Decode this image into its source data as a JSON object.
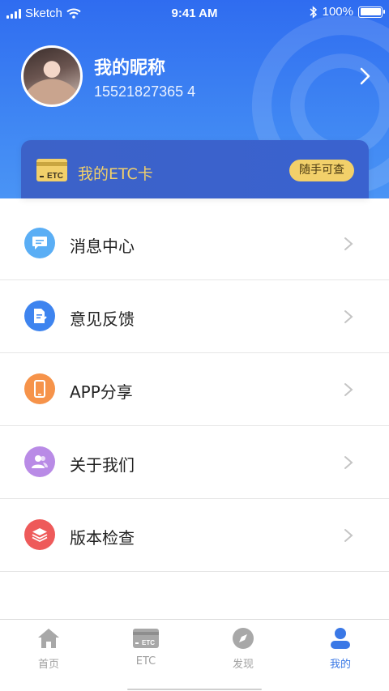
{
  "status_bar": {
    "carrier": "Sketch",
    "time": "9:41 AM",
    "battery": "100%"
  },
  "profile": {
    "nickname": "我的昵称",
    "phone": "15521827365 4"
  },
  "etc_card": {
    "icon_text": "ETC",
    "title": "我的ETC卡",
    "badge": "随手可查"
  },
  "menu": {
    "items": [
      {
        "label": "消息中心",
        "icon": "message-icon",
        "color": "#5aaef5"
      },
      {
        "label": "意见反馈",
        "icon": "feedback-icon",
        "color": "#3e84ef"
      },
      {
        "label": "APP分享",
        "icon": "phone-icon",
        "color": "#f6934a"
      },
      {
        "label": "关于我们",
        "icon": "users-icon",
        "color": "#b98be6"
      },
      {
        "label": "版本检查",
        "icon": "layers-icon",
        "color": "#ee5a5a"
      }
    ]
  },
  "tabbar": {
    "tabs": [
      {
        "label": "首页",
        "icon": "home-icon",
        "active": false
      },
      {
        "label": "ETC",
        "icon": "etc-card-icon",
        "active": false
      },
      {
        "label": "发现",
        "icon": "compass-icon",
        "active": false
      },
      {
        "label": "我的",
        "icon": "user-icon",
        "active": true
      }
    ]
  },
  "colors": {
    "header_blue": "#2f6cf0",
    "accent_yellow": "#f2d06a",
    "active_tab": "#3a78e6"
  }
}
